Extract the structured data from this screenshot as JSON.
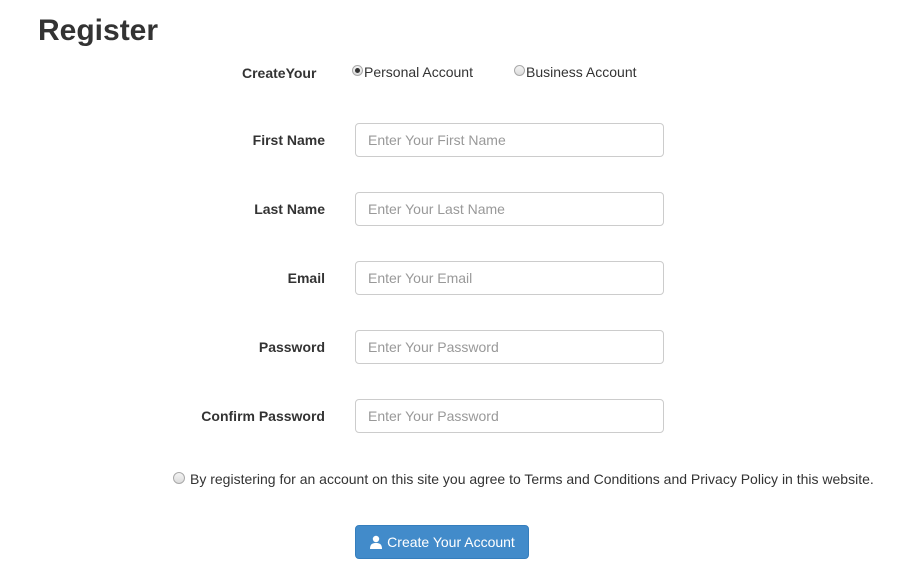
{
  "page": {
    "title": "Register"
  },
  "account_type": {
    "label": "CreateYour",
    "options": [
      {
        "label": "Personal Account",
        "checked": true
      },
      {
        "label": "Business Account",
        "checked": false
      }
    ]
  },
  "fields": [
    {
      "label": "First Name",
      "placeholder": "Enter Your First Name",
      "value": ""
    },
    {
      "label": "Last Name",
      "placeholder": "Enter Your Last Name",
      "value": ""
    },
    {
      "label": "Email",
      "placeholder": "Enter Your Email",
      "value": ""
    },
    {
      "label": "Password",
      "placeholder": "Enter Your Password",
      "value": ""
    },
    {
      "label": "Confirm Password",
      "placeholder": "Enter Your Password",
      "value": ""
    }
  ],
  "terms": {
    "text": "By registering for an account on this site you agree to Terms and Conditions and Privacy Policy in this website.",
    "checked": false
  },
  "submit": {
    "label": "Create Your Account",
    "icon": "user-icon",
    "color": "#428bca"
  }
}
